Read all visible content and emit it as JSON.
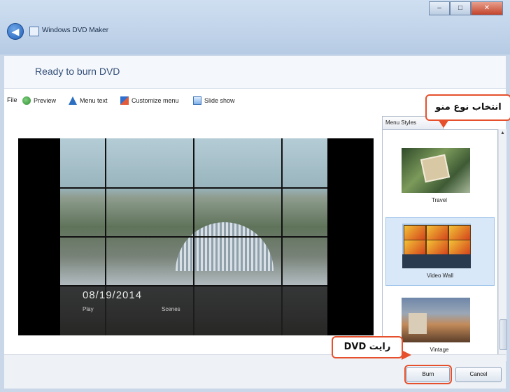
{
  "window": {
    "title": "Windows DVD Maker",
    "controls": {
      "minimize": "–",
      "maximize": "□",
      "close": "✕"
    }
  },
  "header": {
    "status": "Ready to burn DVD"
  },
  "toolbar": {
    "items": [
      {
        "label": "File",
        "icon": "none"
      },
      {
        "label": "Preview",
        "icon": "preview-icon"
      },
      {
        "label": "Menu text",
        "icon": "menu-text-icon"
      },
      {
        "label": "Customize menu",
        "icon": "customize-menu-icon"
      },
      {
        "label": "Slide show",
        "icon": "slide-show-icon"
      }
    ]
  },
  "preview": {
    "date": "08/19/2014",
    "play_label": "Play",
    "scenes_label": "Scenes"
  },
  "menu_styles": {
    "tab_label": "Menu Styles",
    "items": [
      {
        "label": "Travel",
        "selected": false
      },
      {
        "label": "Video Wall",
        "selected": true
      },
      {
        "label": "Vintage",
        "selected": false
      }
    ]
  },
  "footer": {
    "burn_label": "Burn",
    "cancel_label": "Cancel"
  },
  "annotations": {
    "styles_callout": "انتخاب نوع منو",
    "burn_callout": "رایت DVD",
    "color": "#e6502c"
  }
}
